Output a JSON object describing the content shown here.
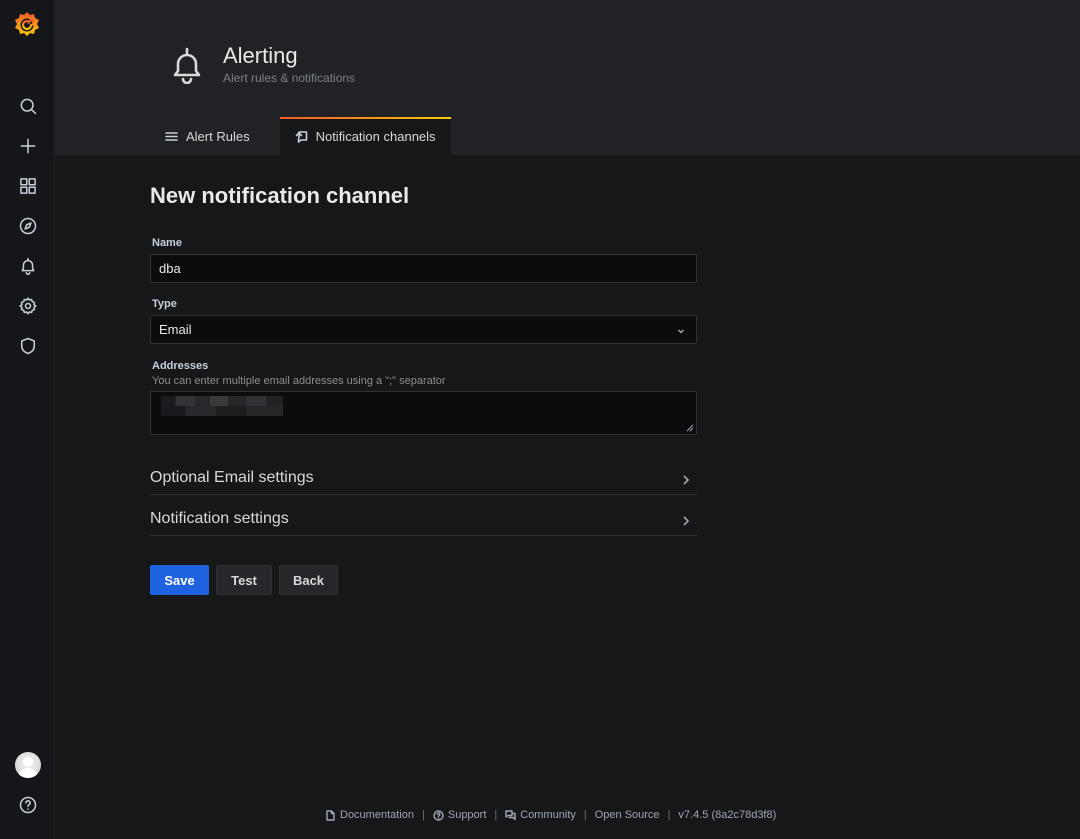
{
  "sidebar": {
    "logo": "grafana-logo",
    "items": [
      {
        "name": "search",
        "icon": "search-icon"
      },
      {
        "name": "create",
        "icon": "plus-icon"
      },
      {
        "name": "dashboards",
        "icon": "apps-icon"
      },
      {
        "name": "explore",
        "icon": "compass-icon"
      },
      {
        "name": "alerting",
        "icon": "bell-icon"
      },
      {
        "name": "configuration",
        "icon": "gear-icon"
      },
      {
        "name": "server-admin",
        "icon": "shield-icon"
      }
    ],
    "bottom": [
      {
        "name": "profile",
        "icon": "avatar"
      },
      {
        "name": "help",
        "icon": "question-circle-icon"
      }
    ]
  },
  "header": {
    "title": "Alerting",
    "subtitle": "Alert rules & notifications",
    "tabs": [
      {
        "label": "Alert Rules",
        "icon": "list-icon",
        "active": false
      },
      {
        "label": "Notification channels",
        "icon": "comment-alt-share-icon",
        "active": true
      }
    ]
  },
  "form": {
    "page_title": "New notification channel",
    "name": {
      "label": "Name",
      "value": "dba"
    },
    "type": {
      "label": "Type",
      "value": "Email"
    },
    "addresses": {
      "label": "Addresses",
      "description": "You can enter multiple email addresses using a \";\" separator",
      "value": "[redacted]"
    },
    "sections": [
      {
        "title": "Optional Email settings"
      },
      {
        "title": "Notification settings"
      }
    ],
    "buttons": {
      "save": "Save",
      "test": "Test",
      "back": "Back"
    }
  },
  "footer": {
    "documentation": "Documentation",
    "support": "Support",
    "community": "Community",
    "open_source": "Open Source",
    "version": "v7.4.5 (8a2c78d3f8)",
    "separator": "|"
  },
  "colors": {
    "primary_button": "#1f62e0",
    "tab_accent_start": "#f05a28",
    "tab_accent_end": "#fbca0a",
    "background": "#161719"
  }
}
